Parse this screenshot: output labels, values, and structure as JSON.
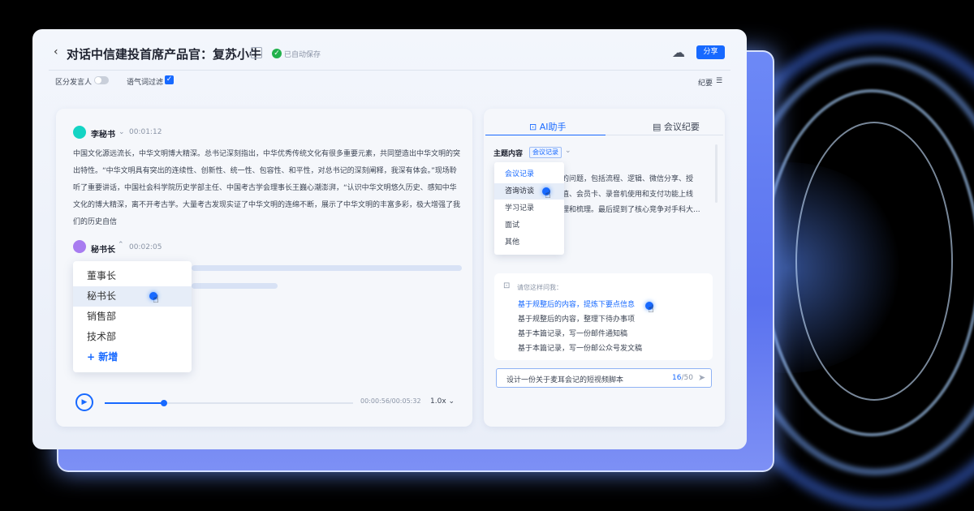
{
  "header": {
    "back_icon": "‹",
    "title": "对话中信建投首席产品官：复苏小牛",
    "save_status": "已自动保存",
    "share_label": "分享"
  },
  "toolbar": {
    "speaker_toggle_label": "区分发言人",
    "filter_label": "语气词过滤",
    "filter_checked": true,
    "minutes_label": "纪要"
  },
  "transcript": {
    "entries": [
      {
        "speaker": "李秘书",
        "time": "00:01:12",
        "avatar_color": "#14d4c4",
        "text": "中国文化源远流长，中华文明博大精深。总书记深刻指出，中华优秀传统文化有很多重要元素，共同塑造出中华文明的突出特性。“中华文明具有突出的连续性、创新性、统一性、包容性、和平性，对总书记的深刻阐释，我深有体会。”现场聆听了重要讲话，中国社会科学院历史学部主任、中国考古学会理事长王巍心潮澎湃，“认识中华文明悠久历史、感知中华文化的博大精深，离不开考古学。大量考古发现实证了中华文明的连绵不断，展示了中华文明的丰富多彩，极大增强了我们的历史自信"
      },
      {
        "speaker": "秘书长",
        "time": "00:02:05",
        "avatar_color": "#a87cf0"
      }
    ],
    "speaker_options": [
      "董事长",
      "秘书长",
      "销售部",
      "技术部"
    ],
    "selected_speaker": "秘书长",
    "add_label": "+ 新增"
  },
  "player": {
    "time": "00:00:56/00:05:32",
    "progress": 0.237,
    "speed": "1.0x"
  },
  "assistant": {
    "tab_ai": "AI助手",
    "tab_minutes": "会议纪要",
    "topic_label": "主题内容",
    "topic_tag": "会议记录",
    "summary_lines": [
      "的问题，包括流程、逻辑、微信分享、授",
      "值、会员卡、录音机使用和支付功能上线",
      "理和梳理。最后提到了核心竞争对手科大..."
    ],
    "topic_options": [
      "会议记录",
      "咨询访谈",
      "学习记录",
      "面试",
      "其他"
    ],
    "selected_topic": "咨询访谈",
    "ask_title": "请您这样问我：",
    "suggestions": [
      "基于规整后的内容，提炼下要点信息",
      "基于规整后的内容，整理下待办事项",
      "基于本篇记录，写一份邮件通知稿",
      "基于本篇记录，写一份邮公众号发文稿"
    ],
    "input_value": "设计一份关于麦耳会记的短视频脚本",
    "input_count": "16",
    "input_max": "/50"
  }
}
